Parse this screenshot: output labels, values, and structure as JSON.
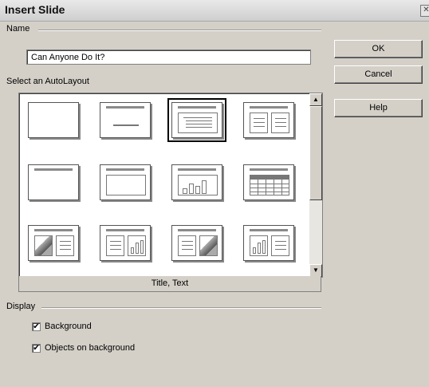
{
  "window": {
    "title": "Insert Slide"
  },
  "name_section": {
    "label": "Name",
    "value": "Can Anyone Do It?"
  },
  "layout_section": {
    "label": "Select an AutoLayout",
    "selected_caption": "Title, Text",
    "layouts": [
      "blank",
      "title-only",
      "title-text",
      "title-2-text",
      "title-bar",
      "title-box",
      "title-chart",
      "title-table",
      "clipart-text",
      "text-chart",
      "text-clipart",
      "chart-text"
    ]
  },
  "buttons": {
    "ok": "OK",
    "cancel": "Cancel",
    "help": "Help"
  },
  "display_section": {
    "label": "Display",
    "background": {
      "label": "Background",
      "checked": true
    },
    "objects": {
      "label": "Objects on background",
      "checked": true
    }
  }
}
